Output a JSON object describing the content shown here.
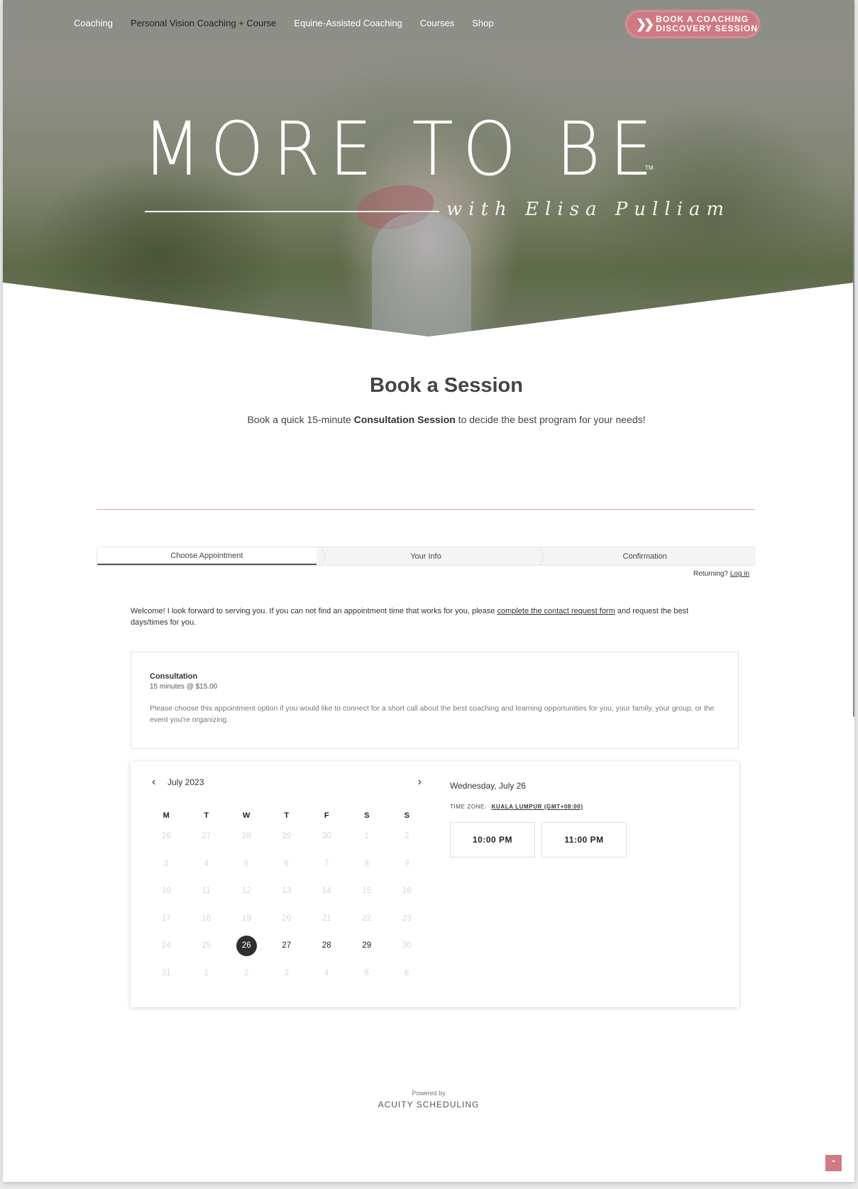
{
  "nav": {
    "items": [
      {
        "label": "Coaching",
        "active": false
      },
      {
        "label": "Personal Vision Coaching + Course",
        "active": true
      },
      {
        "label": "Equine-Assisted Coaching",
        "active": false
      },
      {
        "label": "Courses",
        "active": false
      },
      {
        "label": "Shop",
        "active": false
      }
    ],
    "cta_line1": "BOOK A COACHING",
    "cta_line2": "DISCOVERY SESSION",
    "cta_color": "#cf7a82"
  },
  "hero": {
    "logo": "MORE TO BE",
    "trademark": "TM",
    "tagline": "with Elisa Pulliam"
  },
  "main": {
    "title": "Book a Session",
    "subtitle_pre": "Book a quick 15-minute ",
    "subtitle_bold": "Consultation Session",
    "subtitle_post": " to decide the best program for your needs!"
  },
  "scheduler": {
    "steps": [
      "Choose Appointment",
      "Your Info",
      "Confirmation"
    ],
    "active_step": 0,
    "returning_label": "Returning?",
    "login_label": "Log in",
    "welcome_pre": "Welcome! I look forward to serving you. If you can not find an appointment time that works for you, please ",
    "welcome_link": "complete the contact request form",
    "welcome_post": " and request the best days/times for you.",
    "appointment": {
      "name": "Consultation",
      "duration_price": "15 minutes @ $15.00",
      "description": "Please choose this appointment option if you would like to connect for a short call about the best coaching and learning opportunities for you, your family, your group, or the event you're organizing."
    },
    "calendar": {
      "month_label": "July 2023",
      "weekdays": [
        "M",
        "T",
        "W",
        "T",
        "F",
        "S",
        "S"
      ],
      "weeks": [
        [
          {
            "d": "26",
            "s": "dim"
          },
          {
            "d": "27",
            "s": "dim"
          },
          {
            "d": "28",
            "s": "dim"
          },
          {
            "d": "29",
            "s": "dim"
          },
          {
            "d": "30",
            "s": "dim"
          },
          {
            "d": "1",
            "s": "dim"
          },
          {
            "d": "2",
            "s": "dim"
          }
        ],
        [
          {
            "d": "3",
            "s": "dim"
          },
          {
            "d": "4",
            "s": "dim"
          },
          {
            "d": "5",
            "s": "dim"
          },
          {
            "d": "6",
            "s": "dim"
          },
          {
            "d": "7",
            "s": "dim"
          },
          {
            "d": "8",
            "s": "dim"
          },
          {
            "d": "9",
            "s": "dim"
          }
        ],
        [
          {
            "d": "10",
            "s": "dim"
          },
          {
            "d": "11",
            "s": "dim"
          },
          {
            "d": "12",
            "s": "dim"
          },
          {
            "d": "13",
            "s": "dim"
          },
          {
            "d": "14",
            "s": "dim"
          },
          {
            "d": "15",
            "s": "dim"
          },
          {
            "d": "16",
            "s": "dim"
          }
        ],
        [
          {
            "d": "17",
            "s": "dim"
          },
          {
            "d": "18",
            "s": "dim"
          },
          {
            "d": "19",
            "s": "dim"
          },
          {
            "d": "20",
            "s": "dim"
          },
          {
            "d": "21",
            "s": "dim"
          },
          {
            "d": "22",
            "s": "dim"
          },
          {
            "d": "23",
            "s": "dim"
          }
        ],
        [
          {
            "d": "24",
            "s": "dim"
          },
          {
            "d": "25",
            "s": "dim"
          },
          {
            "d": "26",
            "s": "sel"
          },
          {
            "d": "27",
            "s": "avail"
          },
          {
            "d": "28",
            "s": "avail"
          },
          {
            "d": "29",
            "s": "avail"
          },
          {
            "d": "30",
            "s": "dim"
          }
        ],
        [
          {
            "d": "31",
            "s": "dim"
          },
          {
            "d": "1",
            "s": "dim"
          },
          {
            "d": "2",
            "s": "dim"
          },
          {
            "d": "3",
            "s": "dim"
          },
          {
            "d": "4",
            "s": "dim"
          },
          {
            "d": "5",
            "s": "dim"
          },
          {
            "d": "6",
            "s": "dim"
          }
        ]
      ]
    },
    "selected_date": "Wednesday, July 26",
    "timezone_label": "TIME ZONE:",
    "timezone_value": "KUALA LUMPUR (GMT+08:00)",
    "time_slots": [
      "10:00 PM",
      "11:00 PM"
    ]
  },
  "footer": {
    "powered_by": "Powered by",
    "brand": "ACUITY SCHEDULING"
  },
  "icons": {
    "prev": "‹",
    "next": "›",
    "cta_chevrons": "»",
    "back_to_top": "^"
  }
}
